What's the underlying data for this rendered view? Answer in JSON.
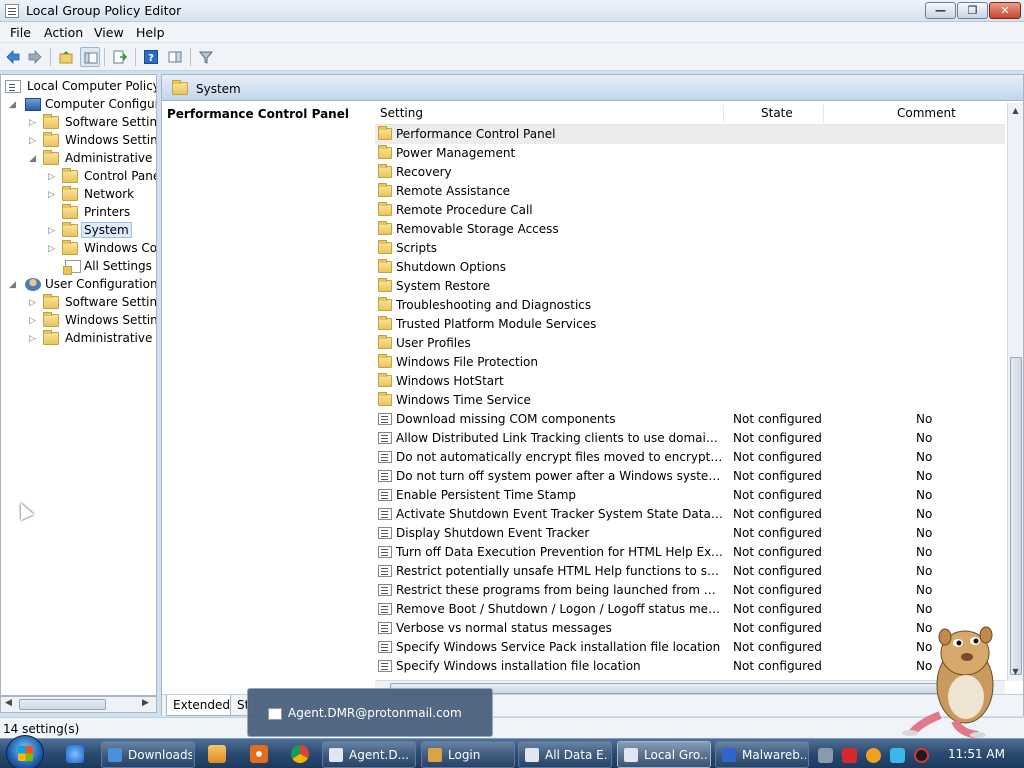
{
  "window": {
    "title": "Local Group Policy Editor",
    "minimize_glyph": "—",
    "maximize_glyph": "❐",
    "close_glyph": "✕"
  },
  "menu": [
    "File",
    "Action",
    "View",
    "Help"
  ],
  "toolbar": {
    "buttons": [
      "back-icon",
      "forward-icon",
      "up-folder-icon",
      "show-hide-tree-icon",
      "export-list-icon",
      "help-icon",
      "properties-pane-icon",
      "filter-icon"
    ]
  },
  "tree": {
    "root": "Local Computer Policy",
    "computer_config": "Computer Configura",
    "software_settings": "Software Settings",
    "windows_settings": "Windows Setting",
    "admin_templates": "Administrative Te",
    "control_panel": "Control Panel",
    "network": "Network",
    "printers": "Printers",
    "system": "System",
    "windows_components": "Windows Cor",
    "all_settings": "All Settings",
    "user_config": "User Configuration",
    "user_software_settings": "Software Settings",
    "user_windows_settings": "Windows Setting",
    "user_admin_templates": "Administrative Te"
  },
  "pane": {
    "header": "System",
    "description_title": "Performance Control Panel"
  },
  "columns": {
    "setting": "Setting",
    "state": "State",
    "comment": "Comment"
  },
  "folders": [
    "Performance Control Panel",
    "Power Management",
    "Recovery",
    "Remote Assistance",
    "Remote Procedure Call",
    "Removable Storage Access",
    "Scripts",
    "Shutdown Options",
    "System Restore",
    "Troubleshooting and Diagnostics",
    "Trusted Platform Module Services",
    "User Profiles",
    "Windows File Protection",
    "Windows HotStart",
    "Windows Time Service"
  ],
  "policies": [
    {
      "name": "Download missing COM components",
      "state": "Not configured",
      "comment": "No"
    },
    {
      "name": "Allow Distributed Link Tracking clients to use domain resour...",
      "state": "Not configured",
      "comment": "No"
    },
    {
      "name": "Do not automatically encrypt files moved to encrypted fold...",
      "state": "Not configured",
      "comment": "No"
    },
    {
      "name": "Do not turn off system power after a Windows system shutd...",
      "state": "Not configured",
      "comment": "No"
    },
    {
      "name": "Enable Persistent Time Stamp",
      "state": "Not configured",
      "comment": "No"
    },
    {
      "name": "Activate Shutdown Event Tracker System State Data feature",
      "state": "Not configured",
      "comment": "No"
    },
    {
      "name": "Display Shutdown Event Tracker",
      "state": "Not configured",
      "comment": "No"
    },
    {
      "name": "Turn off Data Execution Prevention for HTML Help Executible",
      "state": "Not configured",
      "comment": "No"
    },
    {
      "name": "Restrict potentially unsafe HTML Help functions to specified...",
      "state": "Not configured",
      "comment": "No"
    },
    {
      "name": "Restrict these programs from being launched from Help",
      "state": "Not configured",
      "comment": "No"
    },
    {
      "name": "Remove Boot / Shutdown / Logon / Logoff status messages",
      "state": "Not configured",
      "comment": "No"
    },
    {
      "name": "Verbose vs normal status messages",
      "state": "Not configured",
      "comment": "No"
    },
    {
      "name": "Specify Windows Service Pack installation file location",
      "state": "Not configured",
      "comment": "No"
    },
    {
      "name": "Specify Windows installation file location",
      "state": "Not configured",
      "comment": "No"
    }
  ],
  "tabs": {
    "extended": "Extended",
    "standard": "St"
  },
  "status": "14 setting(s)",
  "popup": {
    "label": "Agent.DMR@protonmail.com"
  },
  "taskbar": {
    "tasks": [
      {
        "label": "Downloads",
        "icon": "chrome-icon",
        "color": "#4a90d9"
      },
      {
        "label": "Agent.D...",
        "icon": "window-icon",
        "color": "#dfe6ef"
      },
      {
        "label": "Login",
        "icon": "lock-icon",
        "color": "#d9a441"
      },
      {
        "label": "All Data E...",
        "icon": "document-icon",
        "color": "#dfe6ef"
      },
      {
        "label": "Local Gro...",
        "icon": "policy-icon",
        "color": "#dfe6ef"
      },
      {
        "label": "Malwareb...",
        "icon": "malwarebytes-icon",
        "color": "#2f66c8"
      }
    ],
    "clock": "11:51 AM"
  }
}
